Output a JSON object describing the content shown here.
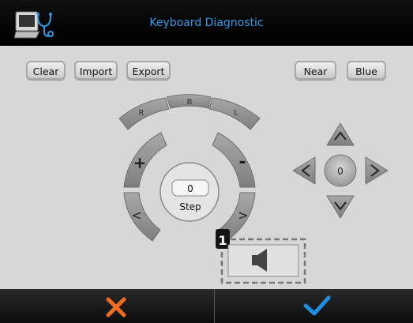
{
  "header": {
    "title": "Keyboard Diagnostic",
    "logo_icon": "diagnostic-logo-icon"
  },
  "toolbar": {
    "clear": "Clear",
    "import": "Import",
    "export": "Export",
    "near": "Near",
    "blue": "Blue"
  },
  "wheel": {
    "r": "R",
    "b": "B",
    "l": "L",
    "plus": "+",
    "minus": "-",
    "left": "<",
    "right": ">",
    "step_value": "0",
    "step_label": "Step"
  },
  "dpad": {
    "center": "0",
    "up_icon": "caret-up-icon",
    "down_icon": "caret-down-icon",
    "left_icon": "caret-left-icon",
    "right_icon": "caret-right-icon"
  },
  "annotation": {
    "number": "1"
  },
  "speaker": {
    "icon": "speaker-icon"
  },
  "footer": {
    "cancel_icon": "x-icon",
    "confirm_icon": "checkmark-icon",
    "cancel_color": "#f26b1d",
    "confirm_color": "#1e8fe0"
  }
}
